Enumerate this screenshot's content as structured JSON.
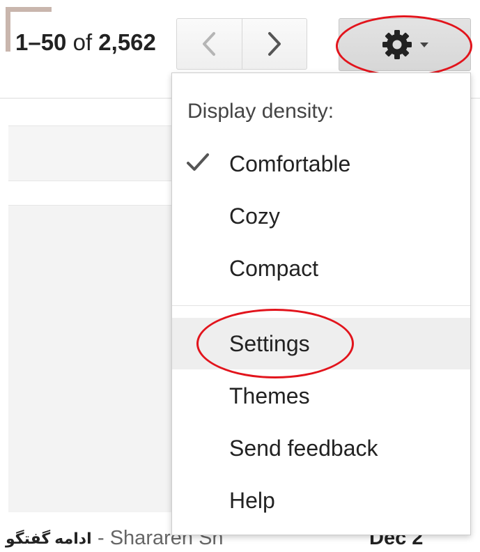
{
  "pagination": {
    "range": "1–50",
    "of_label": "of",
    "total": "2,562",
    "prev_icon": "chevron-left-icon",
    "next_icon": "chevron-right-icon"
  },
  "settings_button": {
    "icon": "gear-icon",
    "caret": "caret-down-icon"
  },
  "menu": {
    "header": "Display density:",
    "density_options": [
      {
        "label": "Comfortable",
        "checked": true
      },
      {
        "label": "Cozy",
        "checked": false
      },
      {
        "label": "Compact",
        "checked": false
      }
    ],
    "items": [
      {
        "label": "Settings",
        "highlighted": true
      },
      {
        "label": "Themes"
      },
      {
        "label": "Send feedback"
      },
      {
        "label": "Help"
      }
    ]
  },
  "email_row": {
    "snippet": "ادامه گفتگو",
    "sender": "- Shararen Sh",
    "date": "Dec 2"
  },
  "colors": {
    "annotation_red": "#e2141c",
    "highlight_bg": "#eeeeee"
  }
}
